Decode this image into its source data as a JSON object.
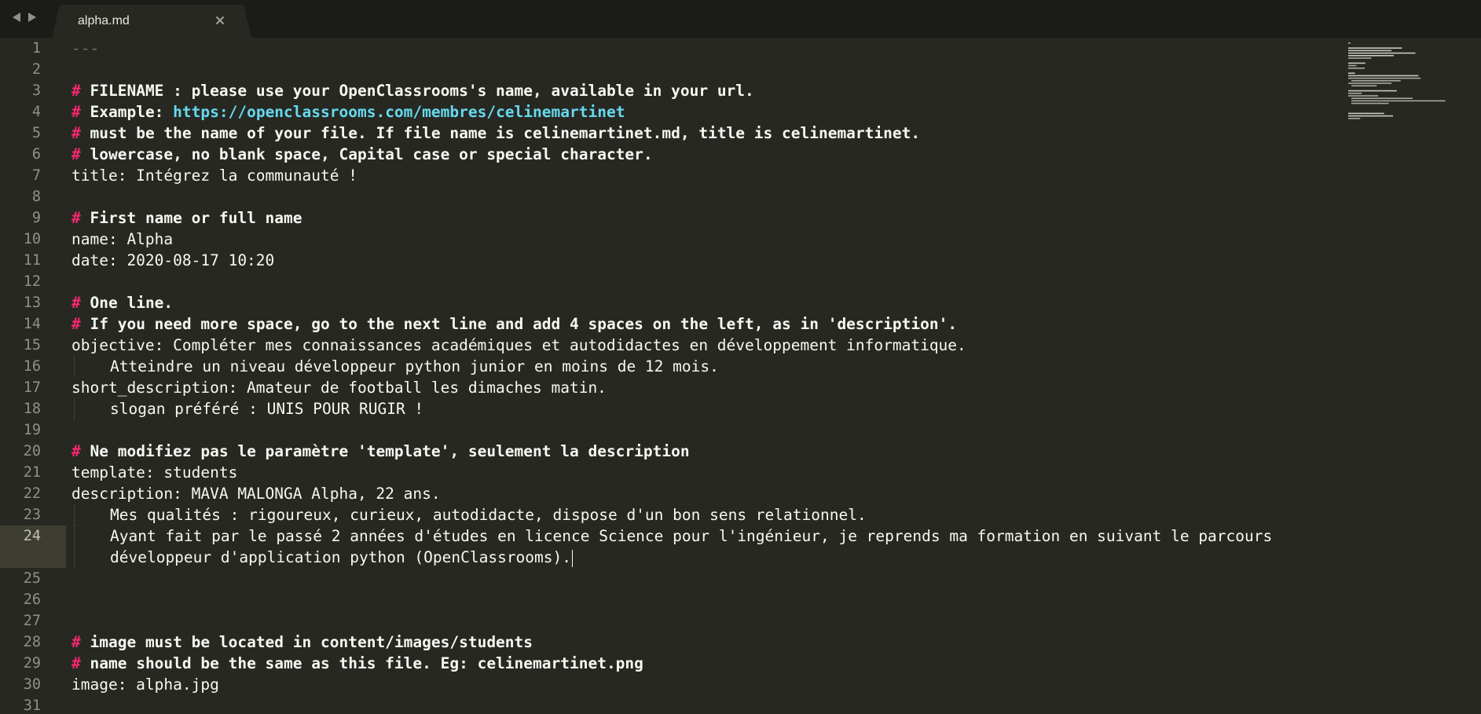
{
  "tabbar": {
    "back_icon": "triangle-left-icon",
    "forward_icon": "triangle-right-icon",
    "tab": {
      "title": "alpha.md",
      "close_icon": "close-icon"
    }
  },
  "editor": {
    "active_line": "24",
    "lines": [
      {
        "n": "1",
        "text": "---"
      },
      {
        "n": "2",
        "text": ""
      },
      {
        "n": "3",
        "text": "FILENAME : please use your OpenClassrooms's name, available in your url."
      },
      {
        "n": "4",
        "text": "Example: ",
        "link": "https://openclassrooms.com/membres/celinemartinet"
      },
      {
        "n": "5",
        "text": "must be the name of your file. If file name is celinemartinet.md, title is celinemartinet."
      },
      {
        "n": "6",
        "text": "lowercase, no blank space, Capital case or special character."
      },
      {
        "n": "7",
        "text": "title: Intégrez la communauté !"
      },
      {
        "n": "8",
        "text": ""
      },
      {
        "n": "9",
        "text": "First name or full name"
      },
      {
        "n": "10",
        "text": "name: Alpha"
      },
      {
        "n": "11",
        "text": "date: 2020-08-17 10:20"
      },
      {
        "n": "12",
        "text": ""
      },
      {
        "n": "13",
        "text": "One line."
      },
      {
        "n": "14",
        "text": "If you need more space, go to the next line and add 4 spaces on the left, as in 'description'."
      },
      {
        "n": "15",
        "text": "objective: Compléter mes connaissances académiques et autodidactes en développement informatique."
      },
      {
        "n": "16",
        "text": "Atteindre un niveau développeur python junior en moins de 12 mois."
      },
      {
        "n": "17",
        "text": "short_description: Amateur de football les dimaches matin."
      },
      {
        "n": "18",
        "text": "slogan préféré : UNIS POUR RUGIR !"
      },
      {
        "n": "19",
        "text": ""
      },
      {
        "n": "20",
        "text": "Ne modifiez pas le paramètre 'template', seulement la description"
      },
      {
        "n": "21",
        "text": "template: students"
      },
      {
        "n": "22",
        "text": "description: MAVA MALONGA Alpha, 22 ans."
      },
      {
        "n": "23",
        "text": "Mes qualités : rigoureux, curieux, autodidacte, dispose d'un bon sens relationnel."
      },
      {
        "n": "24",
        "text": "Ayant fait par le passé 2 années d'études en licence Science pour l'ingénieur, je reprends ma formation en suivant le parcours",
        "text2": "développeur d'application python (OpenClassrooms)."
      },
      {
        "n": "25",
        "text": ""
      },
      {
        "n": "26",
        "text": ""
      },
      {
        "n": "27",
        "text": ""
      },
      {
        "n": "28",
        "text": "image must be located in content/images/students"
      },
      {
        "n": "29",
        "text": "name should be the same as this file. Eg: celinemartinet.png"
      },
      {
        "n": "30",
        "text": "image: alpha.jpg"
      },
      {
        "n": "31",
        "text": ""
      }
    ],
    "hash_mark": "#"
  },
  "colors": {
    "background": "#272822",
    "tabbar": "#1b1c17",
    "comment_hash": "#f92672",
    "link": "#66d9ef",
    "line_number": "#8f908a"
  }
}
